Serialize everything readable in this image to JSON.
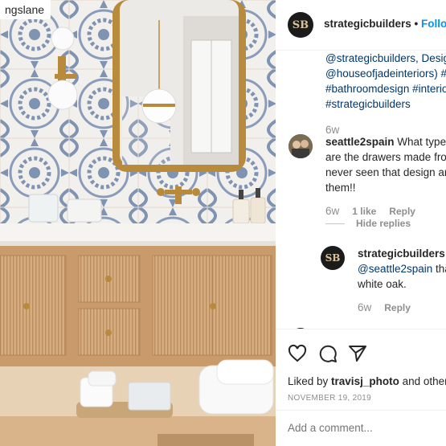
{
  "photo": {
    "tag_text": "ngslane"
  },
  "header": {
    "avatar_text": "SB",
    "username": "strategicbuilders",
    "separator": " • ",
    "follow": "Follow"
  },
  "caption": {
    "lines": [
      "@strategicbuilders, Desig",
      "@houseofjadeinteriors) #",
      "#bathroomdesign #interio",
      "#strategicbuilders"
    ],
    "time": "6w"
  },
  "comment1": {
    "username": "seattle2spain",
    "text_line1": " What type",
    "text_line2": "are the drawers made fro",
    "text_line3": "never seen that design ar",
    "text_line4": "them!!",
    "time": "6w",
    "likes": "1 like",
    "reply": "Reply",
    "hide_replies": "Hide replies"
  },
  "reply1": {
    "username": "strategicbuilders",
    "mention": "@seattle2spain",
    "text_line1_rest": " tha",
    "text_line2": "white oak.",
    "time": "6w",
    "reply": "Reply"
  },
  "footer": {
    "liked_prefix": "Liked by ",
    "liked_user": "travisj_photo",
    "liked_suffix": " and other",
    "date": "NOVEMBER 19, 2019",
    "add_comment_placeholder": "Add a comment..."
  },
  "icons": [
    "heart-icon",
    "comment-icon",
    "share-icon"
  ],
  "colors": {
    "link_blue": "#00376b",
    "follow_blue": "#0095f6",
    "muted_gray": "#8e8e8e",
    "tile_blue": "#7f93b3",
    "wood": "#d4a97a"
  }
}
